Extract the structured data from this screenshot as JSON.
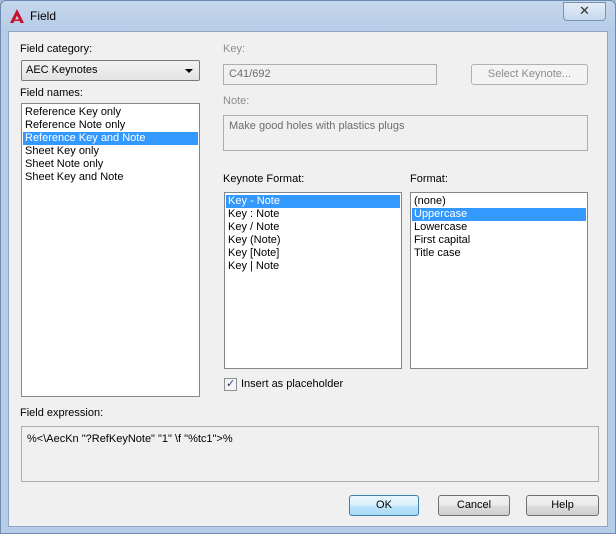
{
  "window": {
    "title": "Field",
    "close_glyph": "✕",
    "app_icon": "autocad-logo-icon"
  },
  "field_category": {
    "label": "Field category:",
    "selected": "AEC Keynotes"
  },
  "field_names": {
    "label": "Field names:",
    "items": [
      "Reference Key only",
      "Reference Note only",
      "Reference Key and Note",
      "Sheet Key only",
      "Sheet Note only",
      "Sheet Key and Note"
    ],
    "selected_index": 2
  },
  "key": {
    "label": "Key:",
    "value": "C41/692",
    "select_button": "Select Keynote..."
  },
  "note": {
    "label": "Note:",
    "value": "Make good holes with plastics plugs"
  },
  "keynote_format": {
    "label": "Keynote Format:",
    "items": [
      "Key - Note",
      "Key : Note",
      "Key / Note",
      "Key (Note)",
      "Key [Note]",
      "Key | Note"
    ],
    "selected_index": 0
  },
  "format": {
    "label": "Format:",
    "items": [
      "(none)",
      "Uppercase",
      "Lowercase",
      "First capital",
      "Title case"
    ],
    "selected_index": 1
  },
  "insert_placeholder": {
    "label": "Insert as placeholder",
    "checked": true,
    "check_glyph": "✓"
  },
  "field_expression": {
    "label": "Field expression:",
    "value": "%<\\AecKn \"?RefKeyNote\" \"1\" \\f \"%tc1\">%"
  },
  "buttons": {
    "ok": "OK",
    "cancel": "Cancel",
    "help": "Help"
  },
  "colors": {
    "selection": "#3399ff",
    "dialog_bg": "#f0f0f0",
    "frame": "#b7cce6"
  }
}
